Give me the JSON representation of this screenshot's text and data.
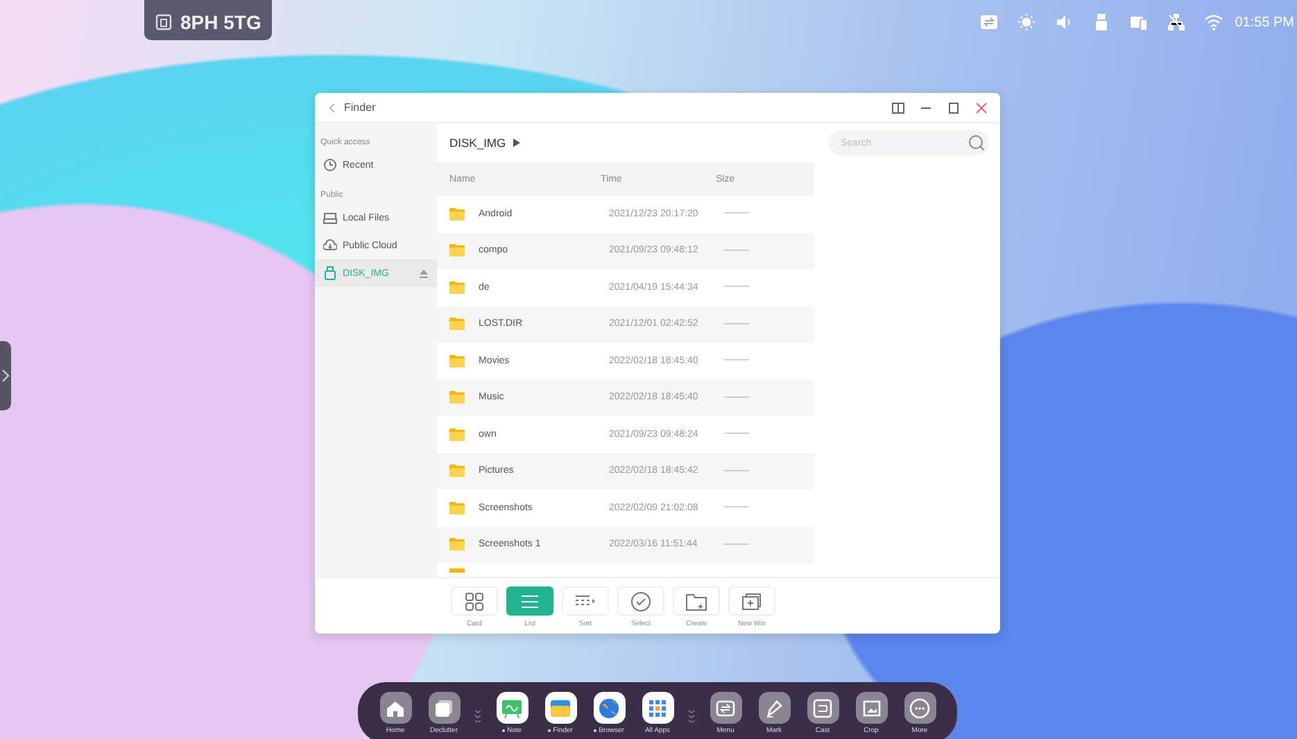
{
  "badge": {
    "text": "8PH 5TG"
  },
  "status_bar": {
    "time": "01:55 PM"
  },
  "window": {
    "title": "Finder",
    "sidebar": {
      "sections": [
        {
          "label": "Quick access",
          "items": [
            {
              "label": "Recent",
              "selected": false,
              "ejectable": false
            }
          ]
        },
        {
          "label": "Public",
          "items": [
            {
              "label": "Local Files",
              "selected": false,
              "ejectable": false
            },
            {
              "label": "Public Cloud",
              "selected": false,
              "ejectable": false
            },
            {
              "label": "DISK_IMG",
              "selected": true,
              "ejectable": true
            }
          ]
        }
      ]
    },
    "path": "DISK_IMG",
    "search": {
      "placeholder": "Search"
    },
    "table": {
      "columns": [
        "Name",
        "Time",
        "Size"
      ],
      "rows": [
        {
          "name": "Android",
          "time": "2021/12/23 20:17:20",
          "size": "———"
        },
        {
          "name": "compo",
          "time": "2021/09/23 09:48:12",
          "size": "———"
        },
        {
          "name": "de",
          "time": "2021/04/19 15:44:34",
          "size": "———"
        },
        {
          "name": "LOST.DIR",
          "time": "2021/12/01 02:42:52",
          "size": "———"
        },
        {
          "name": "Movies",
          "time": "2022/02/18 18:45:40",
          "size": "———"
        },
        {
          "name": "Music",
          "time": "2022/02/18 18:45:40",
          "size": "———"
        },
        {
          "name": "own",
          "time": "2021/09/23 09:48:24",
          "size": "———"
        },
        {
          "name": "Pictures",
          "time": "2022/02/18 18:45:42",
          "size": "———"
        },
        {
          "name": "Screenshots",
          "time": "2022/02/09 21:02:08",
          "size": "———"
        },
        {
          "name": "Screenshots 1",
          "time": "2022/03/16 11:51:44",
          "size": "———"
        }
      ]
    },
    "toolbar": [
      {
        "label": "Card",
        "selected": false
      },
      {
        "label": "List",
        "selected": true
      },
      {
        "label": "Sort",
        "selected": false
      },
      {
        "label": "Select",
        "selected": false
      },
      {
        "label": "Create",
        "selected": false
      },
      {
        "label": "New Win",
        "selected": false
      }
    ]
  },
  "dock": {
    "groups": [
      [
        {
          "label": "Home",
          "running": false
        },
        {
          "label": "Declutter",
          "running": false
        }
      ],
      [
        {
          "label": "Note",
          "running": true
        },
        {
          "label": "Finder",
          "running": true
        },
        {
          "label": "Browser",
          "running": true
        },
        {
          "label": "All Apps",
          "running": false
        }
      ],
      [
        {
          "label": "Menu",
          "running": false
        },
        {
          "label": "Mark",
          "running": false
        },
        {
          "label": "Cast",
          "running": false
        },
        {
          "label": "Crop",
          "running": false
        },
        {
          "label": "More",
          "running": false
        }
      ]
    ]
  }
}
